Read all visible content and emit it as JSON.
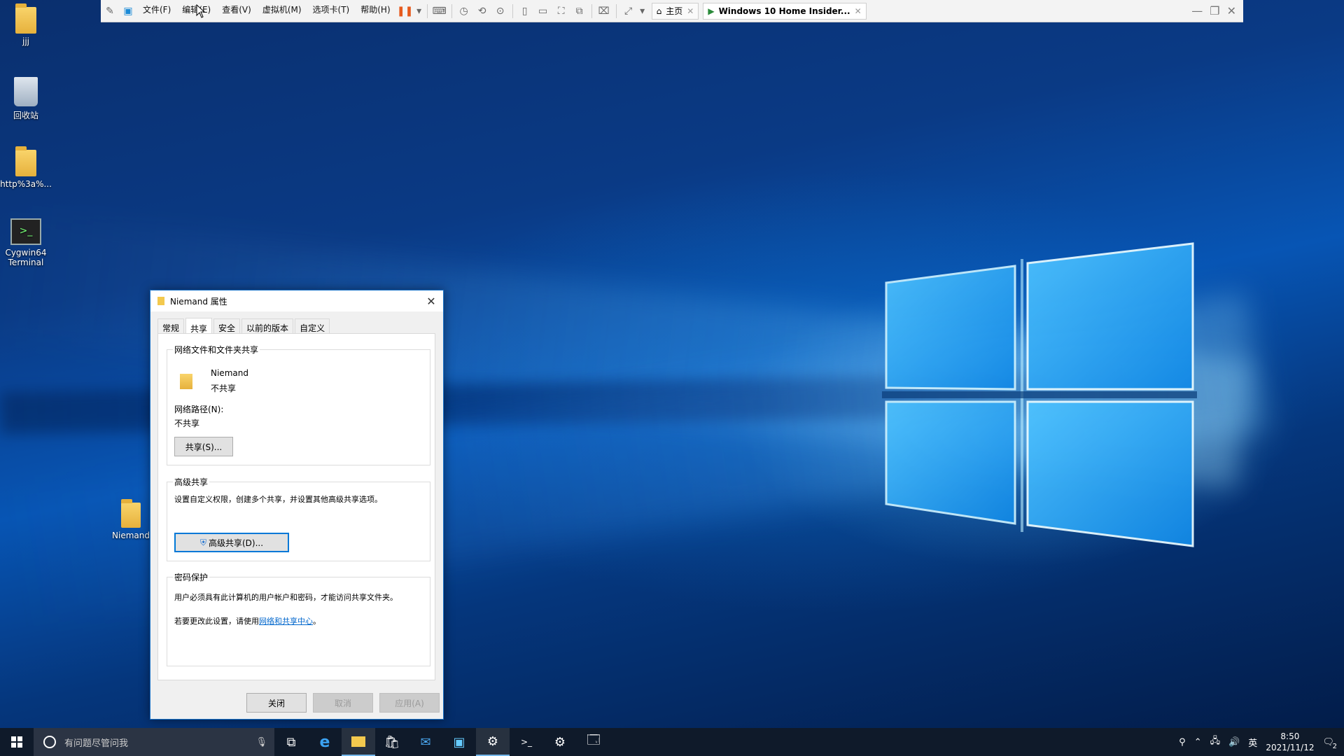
{
  "vmware": {
    "menu": [
      "文件(F)",
      "编辑(E)",
      "查看(V)",
      "虚拟机(M)",
      "选项卡(T)",
      "帮助(H)"
    ],
    "tabs": [
      {
        "label": "主页",
        "active": false
      },
      {
        "label": "Windows 10 Home Insider...",
        "active": true
      }
    ]
  },
  "desktop": {
    "icons": [
      {
        "label": "jjj",
        "icon": "user-folder-icon"
      },
      {
        "label": "回收站",
        "icon": "recycle-bin-icon"
      },
      {
        "label": "http%3a%...",
        "icon": "folder-icon"
      },
      {
        "label": "Cygwin64 Terminal",
        "icon": "terminal-icon"
      },
      {
        "label": "Niemand",
        "icon": "folder-icon"
      }
    ]
  },
  "dialog": {
    "title": "Niemand 属性",
    "tabs": [
      "常规",
      "共享",
      "安全",
      "以前的版本",
      "自定义"
    ],
    "selected_tab": "共享",
    "network_sharing": {
      "group_label": "网络文件和文件夹共享",
      "folder_name": "Niemand",
      "status": "不共享",
      "path_label": "网络路径(N):",
      "path_value": "不共享",
      "share_button": "共享(S)..."
    },
    "advanced": {
      "group_label": "高级共享",
      "description": "设置自定义权限，创建多个共享，并设置其他高级共享选项。",
      "button": "高级共享(D)..."
    },
    "password": {
      "group_label": "密码保护",
      "description": "用户必须具有此计算机的用户帐户和密码，才能访问共享文件夹。",
      "change_prefix": "若要更改此设置，请使用",
      "link": "网络和共享中心",
      "change_suffix": "。"
    },
    "buttons": {
      "close": "关闭",
      "cancel": "取消",
      "apply": "应用(A)"
    }
  },
  "taskbar": {
    "search_placeholder": "有问题尽管问我",
    "ime": "英",
    "time": "8:50",
    "date": "2021/11/12",
    "notification_count": "2"
  }
}
